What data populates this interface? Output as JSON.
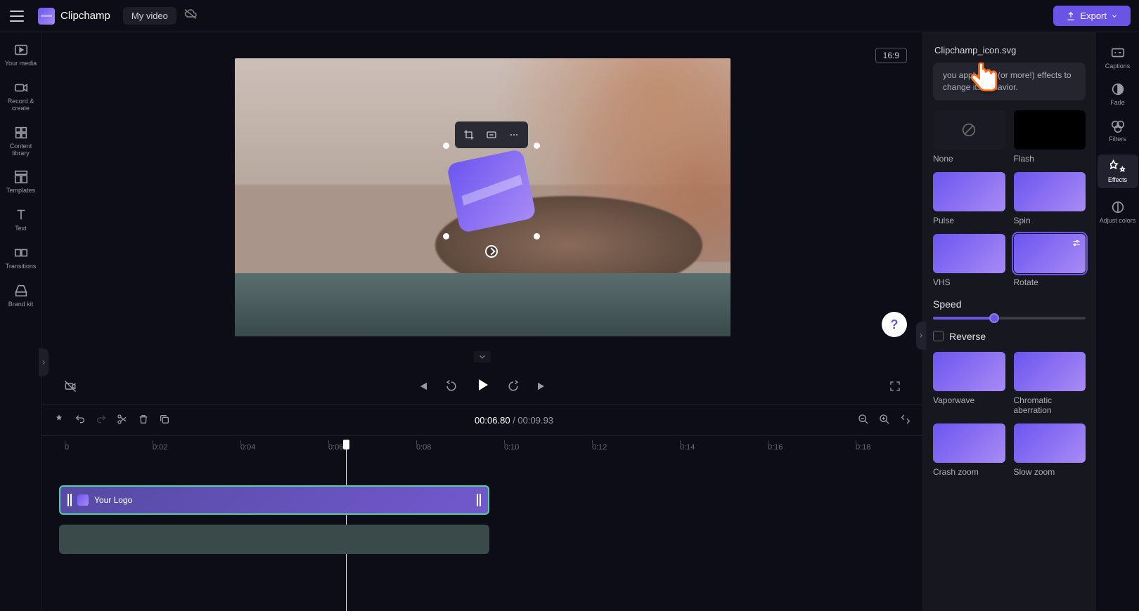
{
  "brand": "Clipchamp",
  "project_name": "My video",
  "export_label": "Export",
  "aspect_ratio": "16:9",
  "left_rail": [
    {
      "label": "Your media"
    },
    {
      "label": "Record & create"
    },
    {
      "label": "Content library"
    },
    {
      "label": "Templates"
    },
    {
      "label": "Text"
    },
    {
      "label": "Transitions"
    },
    {
      "label": "Brand kit"
    }
  ],
  "right_rail": [
    {
      "label": "Captions"
    },
    {
      "label": "Fade"
    },
    {
      "label": "Filters"
    },
    {
      "label": "Effects"
    },
    {
      "label": "Adjust colors"
    }
  ],
  "panel": {
    "filename": "Clipchamp_icon.svg",
    "info_text": "you apply one (or more!) effects to change its behavior.",
    "speed_label": "Speed",
    "reverse_label": "Reverse",
    "effects": [
      {
        "name": "None",
        "kind": "none"
      },
      {
        "name": "Flash",
        "kind": "flash"
      },
      {
        "name": "Pulse",
        "kind": "grad"
      },
      {
        "name": "Spin",
        "kind": "grad"
      },
      {
        "name": "VHS",
        "kind": "grad"
      },
      {
        "name": "Rotate",
        "kind": "grad",
        "selected": true,
        "tune": true
      }
    ],
    "effects2": [
      {
        "name": "Vaporwave",
        "kind": "grad"
      },
      {
        "name": "Chromatic aberration",
        "kind": "grad"
      },
      {
        "name": "Crash zoom",
        "kind": "grad"
      },
      {
        "name": "Slow zoom",
        "kind": "grad"
      }
    ]
  },
  "time": {
    "current": "00:06.80",
    "sep": " / ",
    "total": "00:09.93"
  },
  "ruler_ticks": [
    "0",
    "0:02",
    "0:04",
    "0:06",
    "0:08",
    "0:10",
    "0:12",
    "0:14",
    "0:16",
    "0:18"
  ],
  "clip_logo_label": "Your Logo",
  "help_glyph": "?"
}
